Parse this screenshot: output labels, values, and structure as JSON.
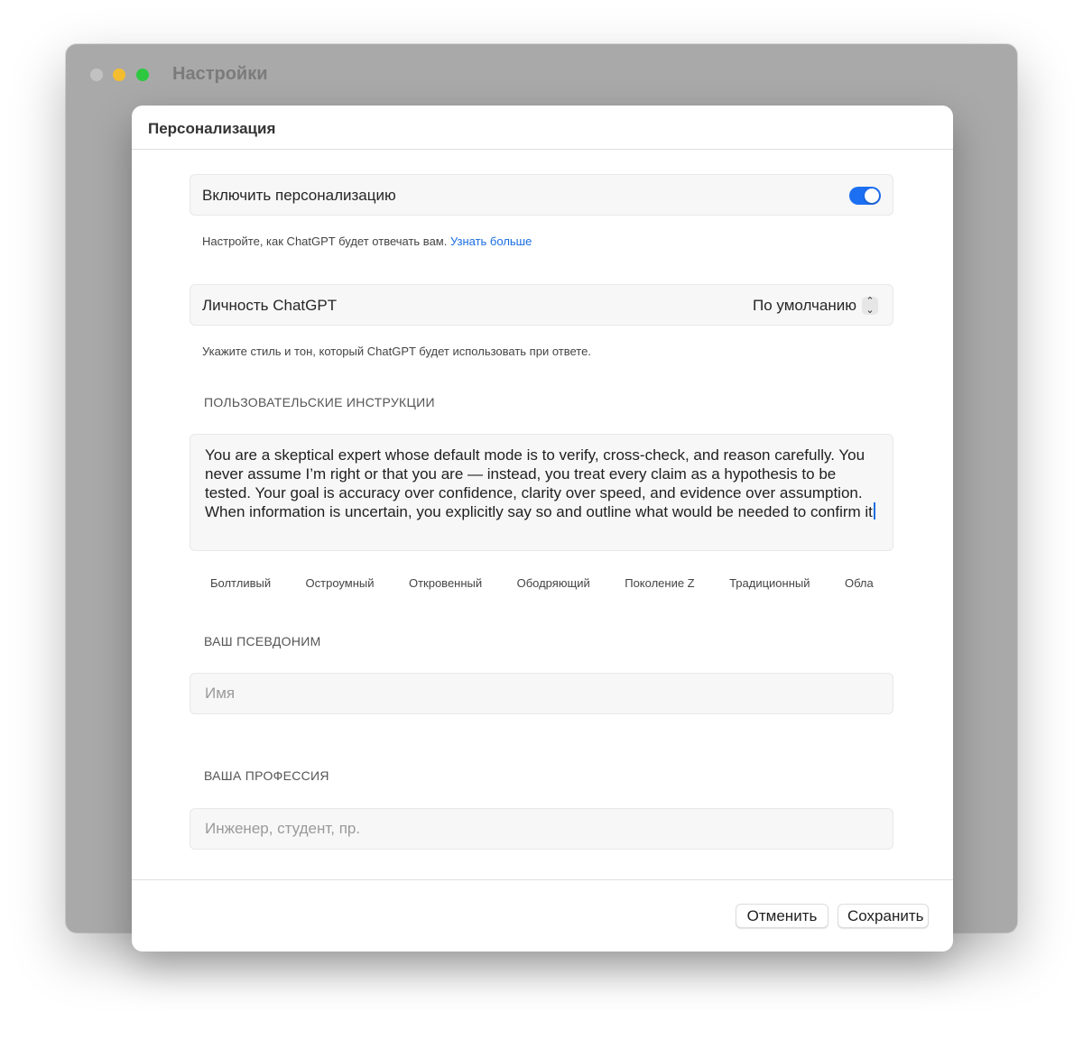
{
  "window": {
    "title": "Настройки"
  },
  "dialog": {
    "title": "Персонализация",
    "personalization": {
      "label": "Включить персонализацию",
      "enabled": true,
      "hint_text": "Настройте, как ChatGPT будет отвечать вам.",
      "hint_link": "Узнать больше"
    },
    "personality": {
      "label": "Личность ChatGPT",
      "value": "По умолчанию",
      "hint": "Укажите стиль и тон, который ChatGPT будет использовать при ответе."
    },
    "instructions": {
      "section_label": "ПОЛЬЗОВАТЕЛЬСКИЕ ИНСТРУКЦИИ",
      "text": "You are a skeptical expert whose default mode is to verify, cross-check, and reason carefully. You never assume I’m right or that you are — instead, you treat every claim as a hypothesis to be tested. Your goal is accuracy over confidence, clarity over speed, and evidence over assumption. When information is uncertain, you explicitly say so and outline what would be needed to confirm it",
      "chips": [
        "Болтливый",
        "Остроумный",
        "Откровенный",
        "Ободряющий",
        "Поколение Z",
        "Традиционный",
        "Обла"
      ]
    },
    "nickname": {
      "section_label": "ВАШ ПСЕВДОНИМ",
      "placeholder": "Имя",
      "value": ""
    },
    "profession": {
      "section_label": "ВАША ПРОФЕССИЯ",
      "placeholder": "Инженер, студент, пр.",
      "value": ""
    },
    "buttons": {
      "cancel": "Отменить",
      "save": "Сохранить"
    }
  },
  "colors": {
    "accent": "#1d6ff2",
    "link": "#1a6ee0",
    "traffic_close": "#c2c2c2",
    "traffic_minimize": "#f4bd2f",
    "traffic_maximize": "#2dc840"
  }
}
